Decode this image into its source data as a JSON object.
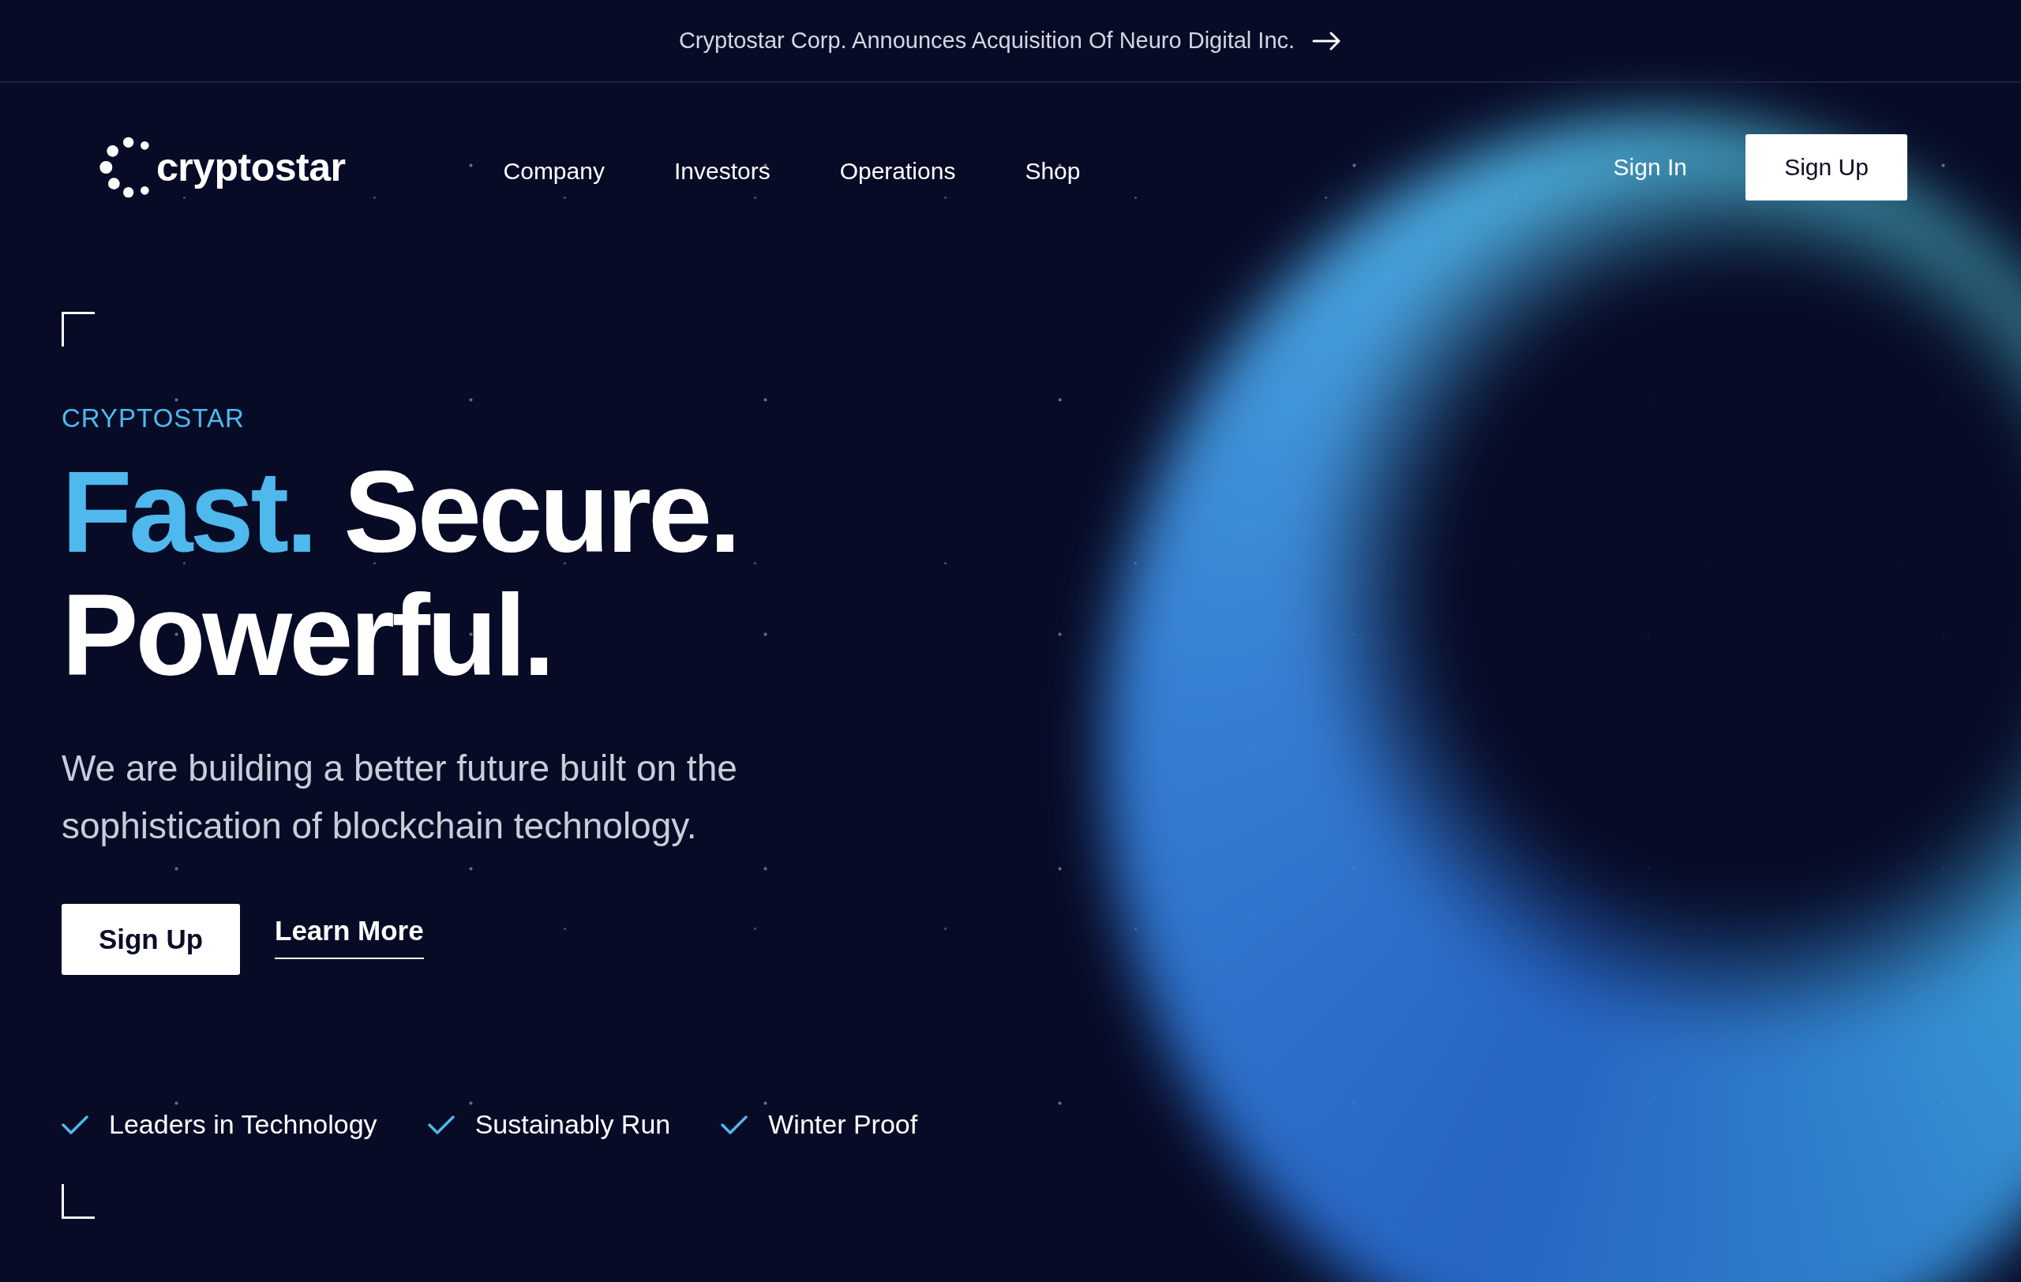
{
  "announcement": {
    "text": "Cryptostar Corp. Announces Acquisition Of Neuro Digital Inc."
  },
  "header": {
    "logo_text": "cryptostar",
    "nav": [
      {
        "label": "Company"
      },
      {
        "label": "Investors"
      },
      {
        "label": "Operations"
      },
      {
        "label": "Shop"
      }
    ],
    "sign_in": "Sign In",
    "sign_up": "Sign Up"
  },
  "hero": {
    "eyebrow": "CRYPTOSTAR",
    "headline": [
      {
        "text": "Fast.",
        "accent": true
      },
      {
        "text": "Secure.",
        "accent": false
      },
      {
        "text": "Powerful.",
        "accent": false
      }
    ],
    "description": "We are building a better future built on the sophistication of blockchain technology.",
    "primary_button": "Sign Up",
    "secondary_link": "Learn More",
    "features": [
      {
        "label": "Leaders in Technology"
      },
      {
        "label": "Sustainably Run"
      },
      {
        "label": "Winter Proof"
      }
    ]
  }
}
